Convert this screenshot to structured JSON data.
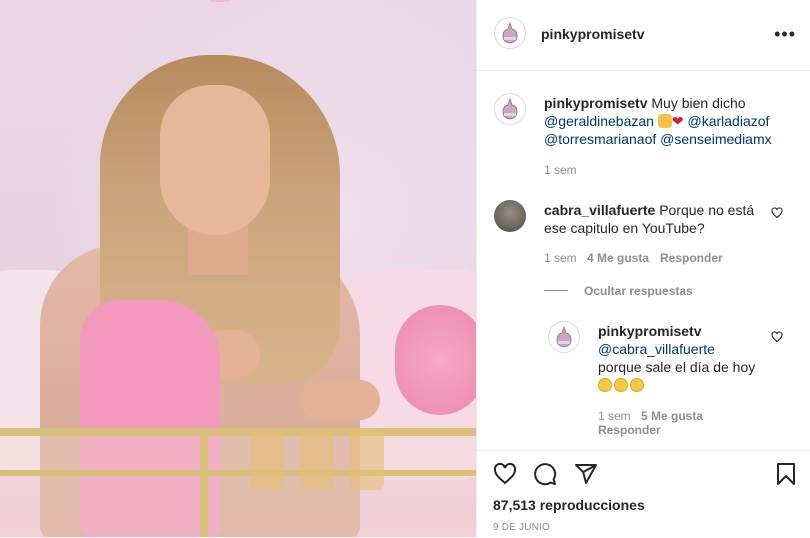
{
  "post": {
    "username": "pinkypromisetv",
    "caption": {
      "username": "pinkypromisetv",
      "text": "Muy bien dicho",
      "mention1": "@geraldinebazan",
      "mention2": "@karladiazof",
      "mention3": "@torresmarianaof",
      "mention4": "@senseimediamx",
      "time": "1 sem"
    },
    "comments": [
      {
        "username": "cabra_villafuerte",
        "text_line1": "Porque no está",
        "text_line2": "ese capitulo en YouTube?",
        "time": "1 sem",
        "likes": "4 Me gusta",
        "reply": "Responder"
      }
    ],
    "hide_replies": "Ocultar respuestas",
    "reply": {
      "username": "pinkypromisetv",
      "mention": "@cabra_villafuerte",
      "text": "porque sale el día de hoy",
      "time": "1 sem",
      "likes": "5 Me gusta",
      "reply": "Responder"
    },
    "views": "87,513 reproducciones",
    "date": "9 DE JUNIO"
  },
  "icons": {
    "more": "more-options-icon",
    "like": "heart-icon",
    "comment": "comment-icon",
    "share": "share-icon",
    "save": "bookmark-icon",
    "emoji_clap": "clapping-hands-emoji",
    "emoji_heart": "heart-emoji",
    "emoji_laugh": "grinning-sweat-emoji"
  },
  "colors": {
    "link": "#00376b",
    "muted": "#8e8e8e",
    "text": "#262626"
  }
}
